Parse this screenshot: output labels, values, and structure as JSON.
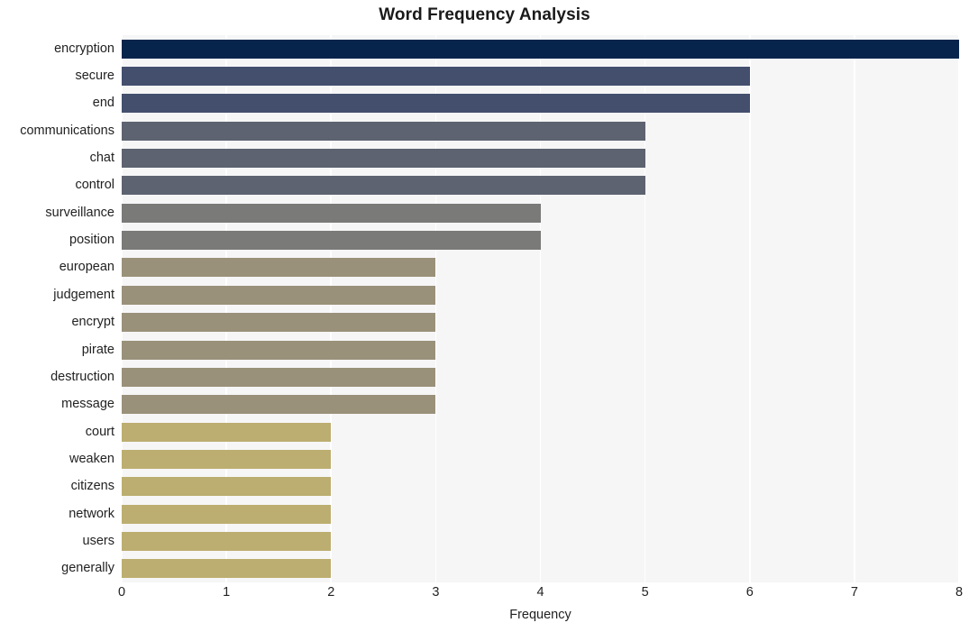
{
  "chart_data": {
    "type": "bar",
    "orientation": "horizontal",
    "title": "Word Frequency Analysis",
    "xlabel": "Frequency",
    "ylabel": "",
    "xlim": [
      0,
      8
    ],
    "xticks": [
      0,
      1,
      2,
      3,
      4,
      5,
      6,
      7,
      8
    ],
    "xtick_labels": [
      "0",
      "1",
      "2",
      "3",
      "4",
      "5",
      "6",
      "7",
      "8"
    ],
    "grid": "vertical-only",
    "legend": "none",
    "categories": [
      "encryption",
      "secure",
      "end",
      "communications",
      "chat",
      "control",
      "surveillance",
      "position",
      "european",
      "judgement",
      "encrypt",
      "pirate",
      "destruction",
      "message",
      "court",
      "weaken",
      "citizens",
      "network",
      "users",
      "generally"
    ],
    "values": [
      8,
      6,
      6,
      5,
      5,
      5,
      4,
      4,
      3,
      3,
      3,
      3,
      3,
      3,
      2,
      2,
      2,
      2,
      2,
      2
    ],
    "bar_colors": [
      "#07254c",
      "#444f6e",
      "#444f6e",
      "#5d6370",
      "#5d6370",
      "#5d6370",
      "#7a7a78",
      "#7a7a78",
      "#9a917a",
      "#9a917a",
      "#9a917a",
      "#9a917a",
      "#9a917a",
      "#9a917a",
      "#bcae70",
      "#bcae70",
      "#bcae70",
      "#bcae70",
      "#bcae70",
      "#bcae70"
    ],
    "plot_background": "#f6f6f7",
    "gridline_color": "#ffffff",
    "figure_background": "#ffffff"
  }
}
